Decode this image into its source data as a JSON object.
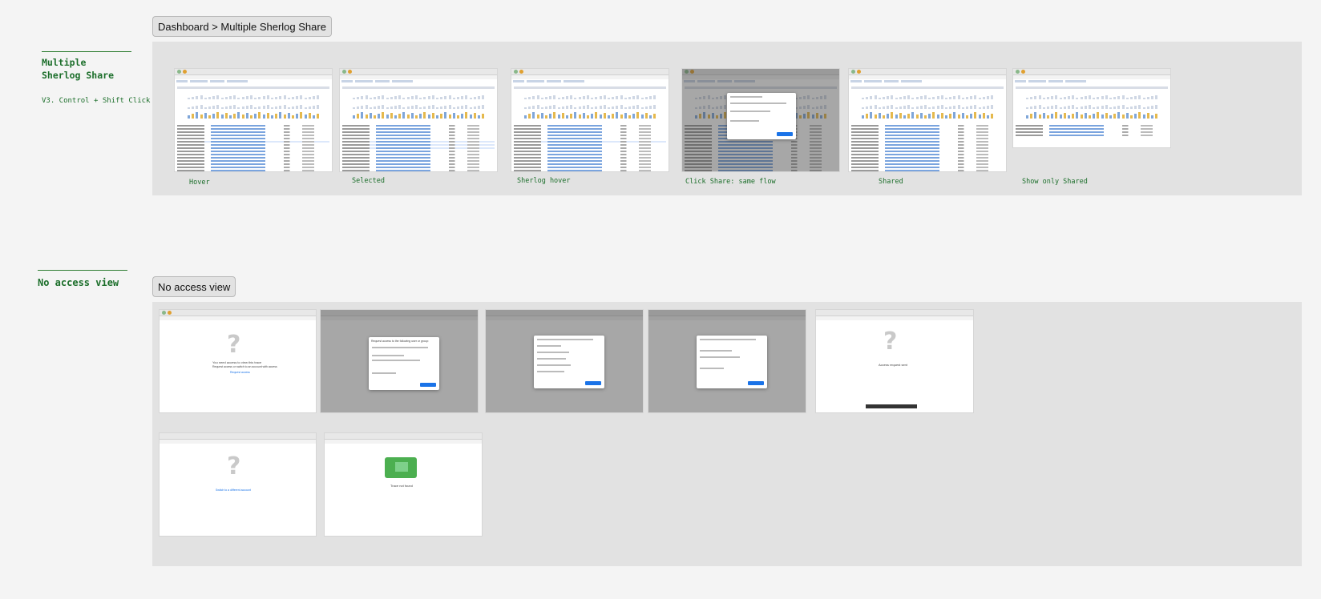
{
  "section_multi": {
    "title": "Multiple\nSherlog Share",
    "subtitle": "V3. Control + Shift Click",
    "frame_label": "Dashboard > Multiple Sherlog Share",
    "captions": [
      "Hover",
      "Selected",
      "Sherlog hover",
      "Click Share: same flow",
      "Shared",
      "Show only Shared"
    ]
  },
  "section_noaccess": {
    "title": "No access view",
    "frame_label": "No access view",
    "screens": {
      "no_access_msg": "You need access to view this trace",
      "no_access_sub": "Request access or switch to an account with access",
      "request_link": "Request access",
      "dialog_title": "Request access to the following user or group:",
      "access_denied_title": "Access request sent",
      "not_found_title": "Trace not found",
      "switch_link": "Switch to a different account"
    }
  },
  "colors": {
    "accent_green": "#1b6e2a",
    "bar_gold": "#e5b94d",
    "bar_blue": "#7fa6d9",
    "link_blue": "#1a73e8"
  },
  "icons": {
    "question": "?"
  }
}
